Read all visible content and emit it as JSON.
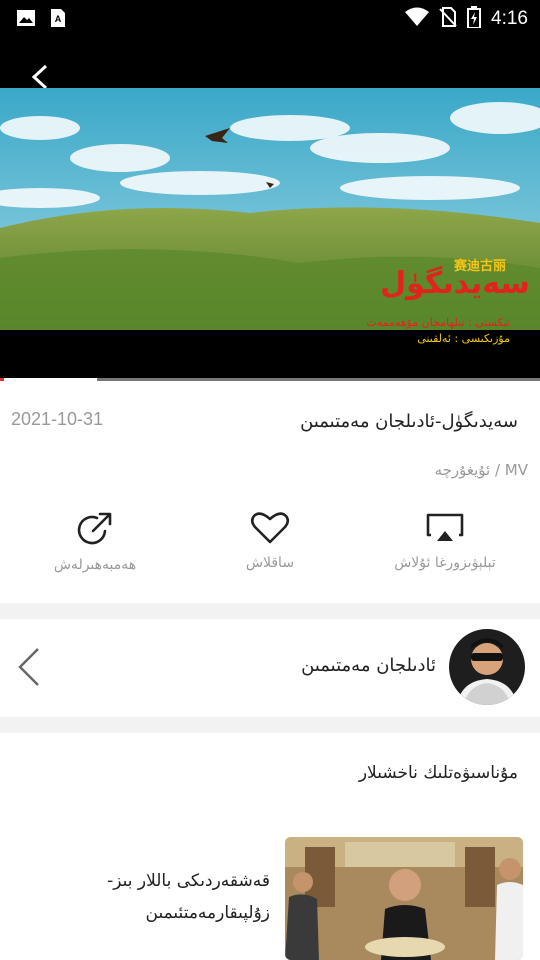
{
  "status_bar": {
    "time": "4:16",
    "left_icons": [
      "image-icon",
      "text-a-icon"
    ],
    "right_icons": [
      "wifi-icon",
      "no-sim-icon",
      "battery-charging-icon"
    ]
  },
  "video": {
    "overlay_title_chinese": "赛迪古丽",
    "overlay_title_uyghur": "سەيدىگۈل",
    "overlay_line1": "تېكستى : تىلھامجان مۇھەممەت",
    "overlay_line2": "مۇزىكىسى : ئەلقىنى",
    "progress_fraction": 0.18
  },
  "info": {
    "title": "سەيدىگۈل-ئادىلجان مەمتىمىن",
    "date": "2021-10-31",
    "category": "MV / ئۇيغۇرچە"
  },
  "actions": [
    {
      "label": "تېلېۋىزورغا ئۇلاش",
      "icon": "cast-icon"
    },
    {
      "label": "ساقلاش",
      "icon": "heart-icon"
    },
    {
      "label": "ھەمبەھىرلەش",
      "icon": "share-icon"
    }
  ],
  "artist": {
    "name": "ئادىلجان مەمتىمىن"
  },
  "recommendations": {
    "heading": "مۇناسىۋەتلىك ناخشىلار",
    "items": [
      {
        "title": "قەشقەردىكى باللار بىز- زۇلپىقارمەمتئىمىن"
      }
    ]
  },
  "colors": {
    "status_bar_bg": "#000000",
    "overlay_red": "#e0231b",
    "overlay_yellow": "#f5c518",
    "muted_text": "#999999"
  }
}
